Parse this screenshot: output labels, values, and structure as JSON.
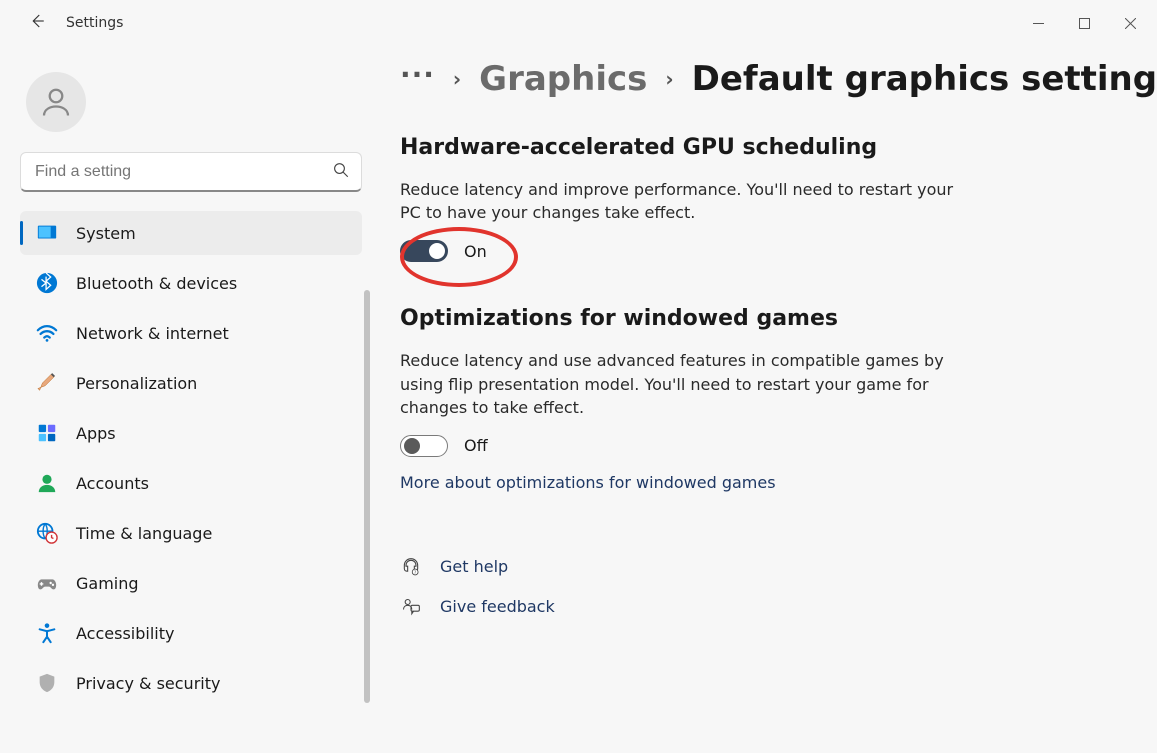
{
  "app_title": "Settings",
  "search": {
    "placeholder": "Find a setting"
  },
  "profile": {
    "name": "",
    "email": ""
  },
  "sidebar": {
    "items": [
      {
        "label": "System",
        "icon": "system"
      },
      {
        "label": "Bluetooth & devices",
        "icon": "bluetooth"
      },
      {
        "label": "Network & internet",
        "icon": "wifi"
      },
      {
        "label": "Personalization",
        "icon": "brush"
      },
      {
        "label": "Apps",
        "icon": "apps"
      },
      {
        "label": "Accounts",
        "icon": "accounts"
      },
      {
        "label": "Time & language",
        "icon": "globe"
      },
      {
        "label": "Gaming",
        "icon": "gamepad"
      },
      {
        "label": "Accessibility",
        "icon": "accessibility"
      },
      {
        "label": "Privacy & security",
        "icon": "shield"
      }
    ]
  },
  "breadcrumb": {
    "dots": "···",
    "parent": "Graphics",
    "current": "Default graphics settings"
  },
  "sections": {
    "gpu": {
      "title": "Hardware-accelerated GPU scheduling",
      "desc": "Reduce latency and improve performance. You'll need to restart your PC to have your changes take effect.",
      "toggle_state": "On"
    },
    "windowed": {
      "title": "Optimizations for windowed games",
      "desc": "Reduce latency and use advanced features in compatible games by using flip presentation model. You'll need to restart your game for changes to take effect.",
      "toggle_state": "Off",
      "link": "More about optimizations for windowed games"
    }
  },
  "footer": {
    "help": "Get help",
    "feedback": "Give feedback"
  }
}
